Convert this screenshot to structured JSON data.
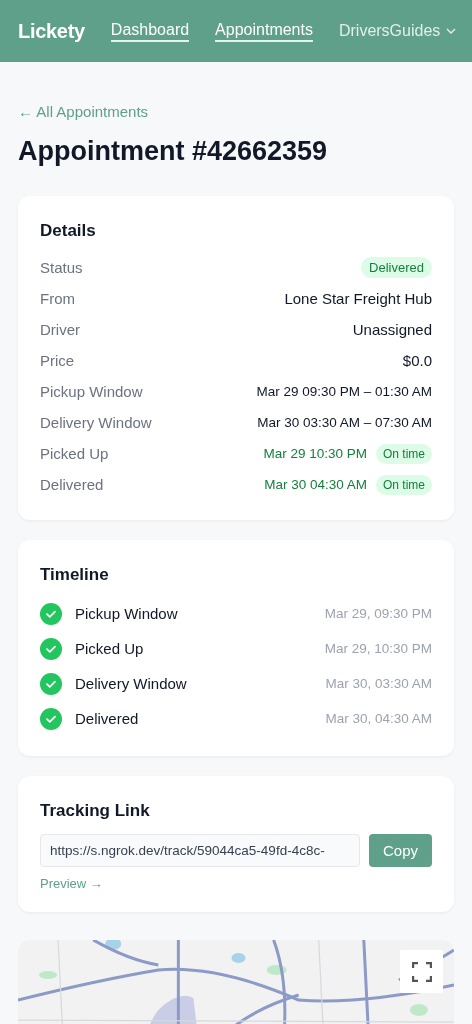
{
  "header": {
    "logo": "Lickety",
    "nav": [
      {
        "label": "Dashboard",
        "kind": "link"
      },
      {
        "label": "Appointments",
        "kind": "link"
      },
      {
        "label": "DriversGuides",
        "kind": "dropdown"
      }
    ]
  },
  "back_link": "← All Appointments",
  "title": "Appointment #42662359",
  "details": {
    "heading": "Details",
    "rows": [
      {
        "label": "Status",
        "kind": "badge",
        "value": "Delivered"
      },
      {
        "label": "From",
        "kind": "text",
        "value": "Lone Star Freight Hub"
      },
      {
        "label": "Driver",
        "kind": "text",
        "value": "Unassigned"
      },
      {
        "label": "Price",
        "kind": "text",
        "value": "$0.0"
      },
      {
        "label": "Pickup Window",
        "kind": "range",
        "value": "Mar 29 09:30 PM – 01:30 AM"
      },
      {
        "label": "Delivery Window",
        "kind": "range",
        "value": "Mar 30 03:30 AM – 07:30 AM"
      },
      {
        "label": "Picked Up",
        "kind": "timed",
        "value": "Mar 29 10:30 PM",
        "badge": "On time"
      },
      {
        "label": "Delivered",
        "kind": "timed",
        "value": "Mar 30 04:30 AM",
        "badge": "On time"
      }
    ]
  },
  "timeline": {
    "heading": "Timeline",
    "items": [
      {
        "label": "Pickup Window",
        "time": "Mar 29, 09:30 PM",
        "done": true
      },
      {
        "label": "Picked Up",
        "time": "Mar 29, 10:30 PM",
        "done": true
      },
      {
        "label": "Delivery Window",
        "time": "Mar 30, 03:30 AM",
        "done": true
      },
      {
        "label": "Delivered",
        "time": "Mar 30, 04:30 AM",
        "done": true
      }
    ]
  },
  "tracking": {
    "heading": "Tracking Link",
    "url": "https://s.ngrok.dev/track/59044ca5-49fd-4c8c-",
    "button": "Copy",
    "preview": "Preview →"
  }
}
